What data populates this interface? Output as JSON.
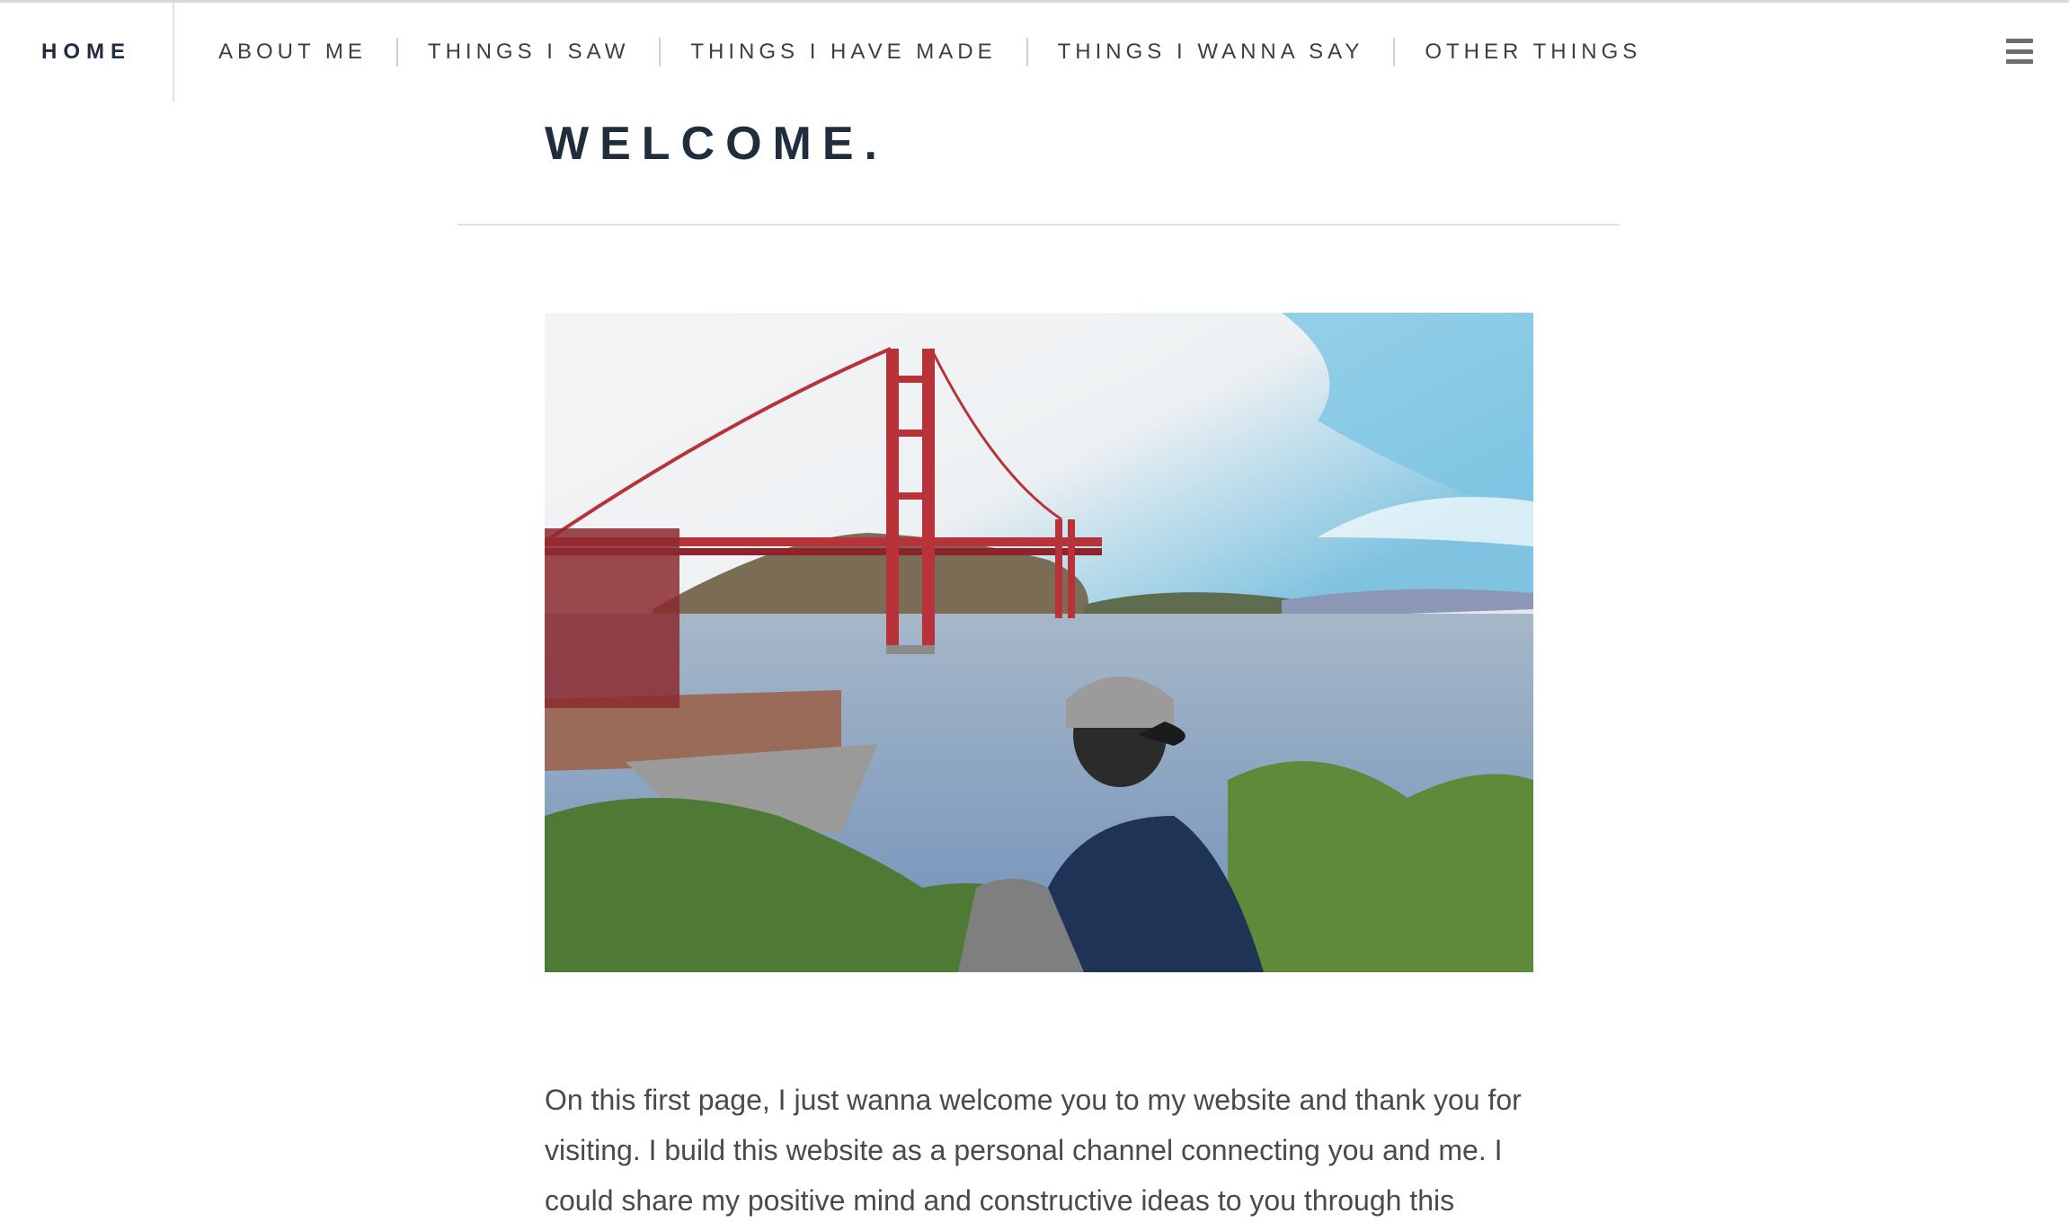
{
  "nav": {
    "home_label": "HOME",
    "items": [
      {
        "label": "ABOUT ME"
      },
      {
        "label": "THINGS I SAW"
      },
      {
        "label": "THINGS I HAVE MADE"
      },
      {
        "label": "THINGS I WANNA SAY"
      },
      {
        "label": "OTHER THINGS"
      }
    ],
    "menu_icon": "hamburger-menu-icon"
  },
  "main": {
    "title": "WELCOME.",
    "hero_image": {
      "description_icon": "golden-gate-photo"
    },
    "body": "On this first page, I just wanna welcome you to my website and thank you for visiting. I build this website as a personal channel connecting you and me. I could share my positive mind and constructive ideas to you through this"
  },
  "colors": {
    "heading": "#1f2d3d",
    "nav_text": "#3a3f47",
    "divider": "#e3e3e3",
    "bridge_red": "#b8323a"
  }
}
